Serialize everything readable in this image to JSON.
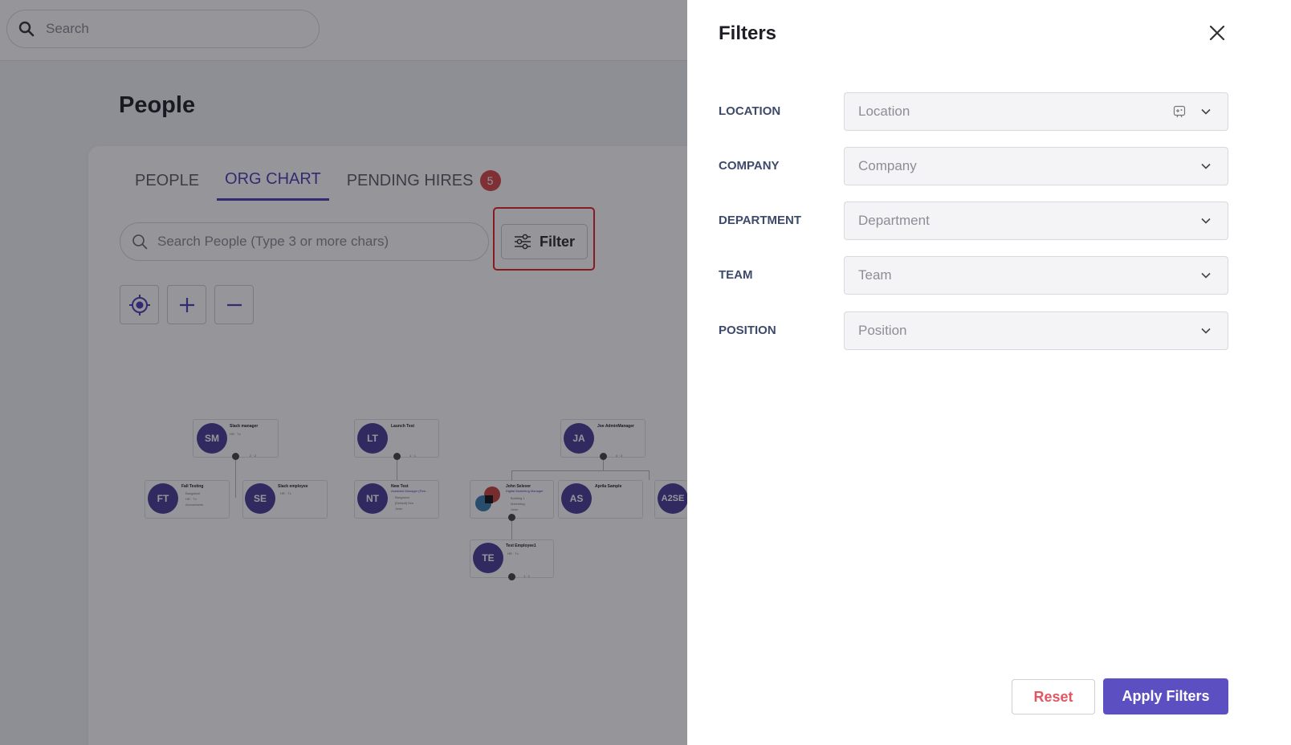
{
  "topbar": {
    "search_placeholder": "Search"
  },
  "page": {
    "title": "People"
  },
  "tabs": [
    {
      "label": "PEOPLE",
      "active": false
    },
    {
      "label": "ORG CHART",
      "active": true
    },
    {
      "label": "PENDING HIRES",
      "active": false,
      "badge": "5"
    }
  ],
  "toolbar": {
    "search_placeholder": "Search People (Type 3 or more chars)",
    "filter_label": "Filter"
  },
  "org_chart": {
    "nodes": [
      {
        "initials": "SM",
        "name": "Slack manager",
        "lines": [
          "HR · Tx",
          "2 · 2"
        ]
      },
      {
        "initials": "LT",
        "name": "Launch Test",
        "lines": [
          "1 · 1"
        ]
      },
      {
        "initials": "JA",
        "name": "Joe AdminManager",
        "lines": [
          "4 · 3"
        ]
      },
      {
        "initials": "FT",
        "name": "Fall Testing",
        "lines": [
          "Bangalore",
          "HR · Tx",
          "Accountants"
        ]
      },
      {
        "initials": "SE",
        "name": "Slack employee",
        "lines": [
          "HR · Tx"
        ]
      },
      {
        "initials": "NT",
        "name": "New Test",
        "lines": [
          "Assistant Manager (Fixe...",
          "Bangalore",
          "[Default] Sen",
          "Jown"
        ]
      },
      {
        "initials": "",
        "name": "John Selever",
        "lines": [
          "Digital Marketing Manager",
          "Building 1",
          "Marketing",
          "Jown"
        ]
      },
      {
        "initials": "AS",
        "name": "Aprila Sample",
        "lines": []
      },
      {
        "initials": "A2SE",
        "name": "",
        "lines": []
      },
      {
        "initials": "TE",
        "name": "Test Employee1",
        "lines": [
          "HR · Tx",
          "1 · 1"
        ]
      }
    ]
  },
  "filters": {
    "title": "Filters",
    "fields": [
      {
        "label": "LOCATION",
        "placeholder": "Location"
      },
      {
        "label": "COMPANY",
        "placeholder": "Company"
      },
      {
        "label": "DEPARTMENT",
        "placeholder": "Department"
      },
      {
        "label": "TEAM",
        "placeholder": "Team"
      },
      {
        "label": "POSITION",
        "placeholder": "Position"
      }
    ],
    "reset_label": "Reset",
    "apply_label": "Apply Filters"
  },
  "colors": {
    "accent": "#5c4fc2",
    "badge": "#d64848",
    "reset_text": "#e05862",
    "avatar": "#4a3d98",
    "highlight": "#e42424"
  }
}
